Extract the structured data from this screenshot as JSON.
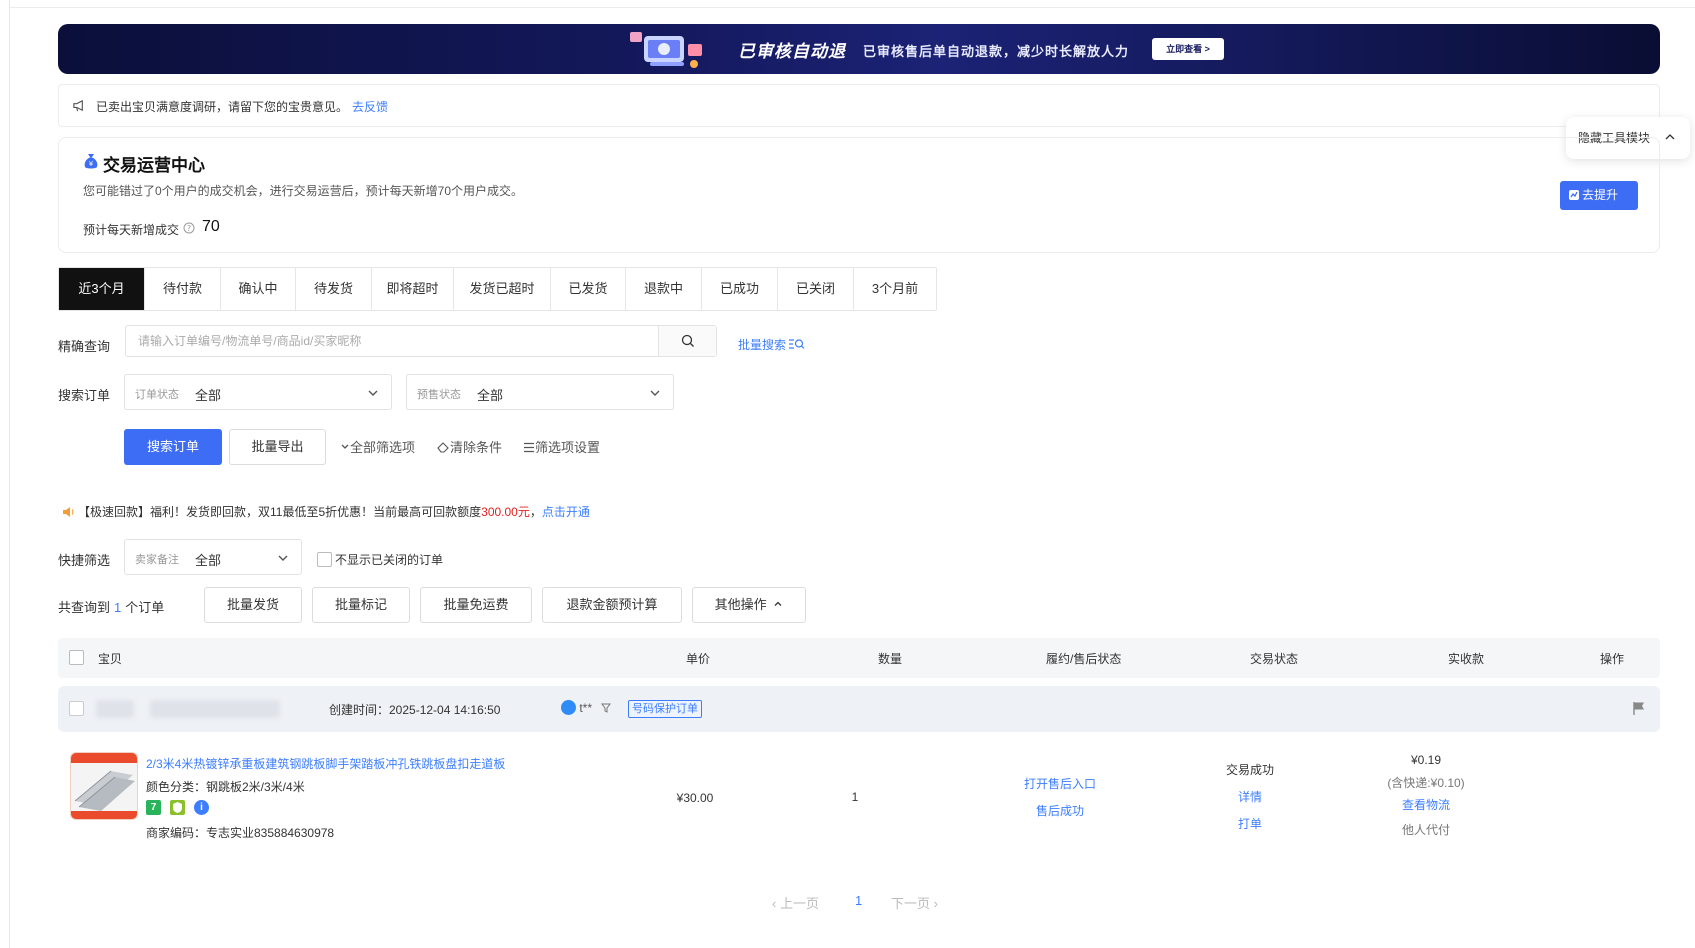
{
  "banner": {
    "title": "已审核自动退",
    "subtitle": "已审核售后单自动退款，减少时长解放人力",
    "button": "立即查看 >"
  },
  "notice": {
    "text": "已卖出宝贝满意度调研，请留下您的宝贵意见。",
    "link": "去反馈"
  },
  "hide_tool": {
    "label": "隐藏工具模块"
  },
  "ops_center": {
    "title": "交易运营中心",
    "desc": "您可能错过了0个用户的成交机会，进行交易运营后，预计每天新增70个用户成交。",
    "estimate_label": "预计每天新增成交",
    "estimate_value": "70",
    "button": "去提升"
  },
  "tabs": [
    {
      "label": "近3个月",
      "active": true
    },
    {
      "label": "待付款"
    },
    {
      "label": "确认中"
    },
    {
      "label": "待发货"
    },
    {
      "label": "即将超时"
    },
    {
      "label": "发货已超时"
    },
    {
      "label": "已发货"
    },
    {
      "label": "退款中"
    },
    {
      "label": "已成功"
    },
    {
      "label": "已关闭"
    },
    {
      "label": "3个月前"
    }
  ],
  "search": {
    "exact_label": "精确查询",
    "placeholder": "请输入订单编号/物流单号/商品id/买家昵称",
    "batch_search": "批量搜索",
    "order_label": "搜索订单",
    "order_status_label": "订单状态",
    "order_status_value": "全部",
    "presale_label": "预售状态",
    "presale_value": "全部",
    "search_button": "搜索订单",
    "export_button": "批量导出",
    "all_filters": "全部筛选项",
    "clear": "清除条件",
    "filter_settings": "筛选项设置"
  },
  "promo": {
    "prefix": "【极速回款】福利！发货即回款，双11最低至5折优惠！当前最高可回款额度",
    "amount": "300.00元",
    "sep": "，",
    "link": "点击开通"
  },
  "quick": {
    "label": "快捷筛选",
    "remark_label": "卖家备注",
    "remark_value": "全部",
    "hide_closed": "不显示已关闭的订单"
  },
  "result": {
    "prefix": "共查询到",
    "count": "1",
    "suffix": "个订单",
    "actions": [
      "批量发货",
      "批量标记",
      "批量免运费",
      "退款金额预计算",
      "其他操作"
    ]
  },
  "table": {
    "headers": {
      "item": "宝贝",
      "price": "单价",
      "qty": "数量",
      "aftersale": "履约/售后状态",
      "trade": "交易状态",
      "received": "实收款",
      "op": "操作"
    },
    "order": {
      "created": "创建时间：2025-12-04 14:16:50",
      "buyer": "t**",
      "tag": "号码保护订单",
      "title": "2/3米4米热镀锌承重板建筑钢跳板脚手架踏板冲孔铁跳板盘扣走道板",
      "color": "颜色分类：钢跳板2米/3米/4米",
      "badge_seven": "7",
      "code": "商家编码：专志实业835884630978",
      "price": "¥30.00",
      "qty": "1",
      "aftersale_entry": "打开售后入口",
      "aftersale_status": "售后成功",
      "trade_status": "交易成功",
      "detail": "详情",
      "print": "打单",
      "received": "¥0.19",
      "shipping": "(含快递:¥0.10)",
      "logistics": "查看物流",
      "proxy": "他人代付"
    }
  },
  "pager": {
    "prev": "上一页",
    "page": "1",
    "next": "下一页"
  },
  "colors": {
    "primary": "#3d6cf5",
    "link": "#3d7eff",
    "accent_red": "#e02020"
  }
}
